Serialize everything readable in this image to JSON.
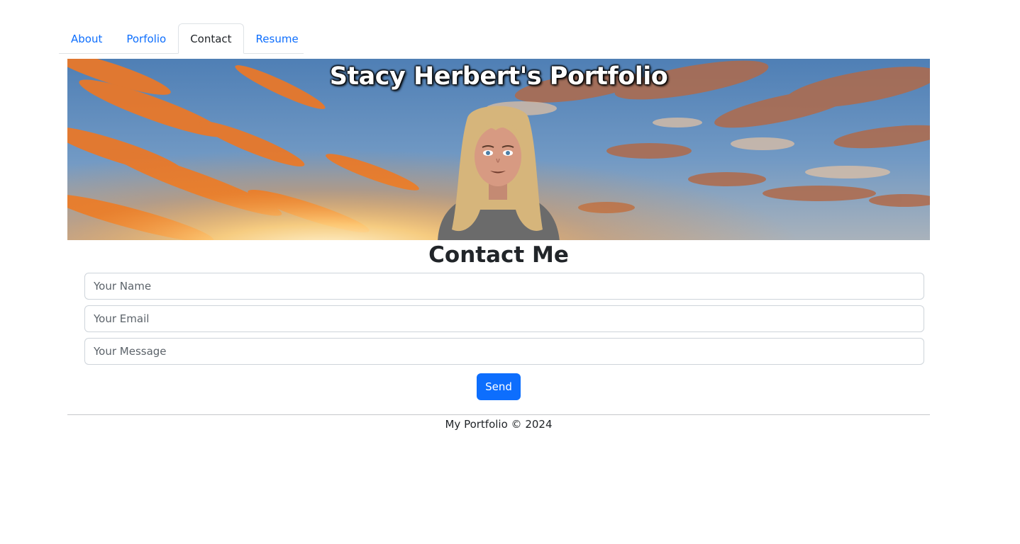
{
  "nav": {
    "tabs": [
      {
        "label": "About",
        "active": false
      },
      {
        "label": "Porfolio",
        "active": false
      },
      {
        "label": "Contact",
        "active": true
      },
      {
        "label": "Resume",
        "active": false
      }
    ]
  },
  "hero": {
    "title": "Stacy Herbert's Portfolio",
    "background": "sunset-sky-clouds",
    "avatar": "cartoon-woman-blonde-hair"
  },
  "contact": {
    "title": "Contact Me",
    "name_placeholder": "Your Name",
    "email_placeholder": "Your Email",
    "message_placeholder": "Your Message",
    "send_label": "Send"
  },
  "footer": {
    "text": "My Portfolio © 2024"
  },
  "colors": {
    "link": "#0d6efd",
    "primary_button": "#0d6efd",
    "text": "#212529",
    "border": "#dee2e6"
  }
}
